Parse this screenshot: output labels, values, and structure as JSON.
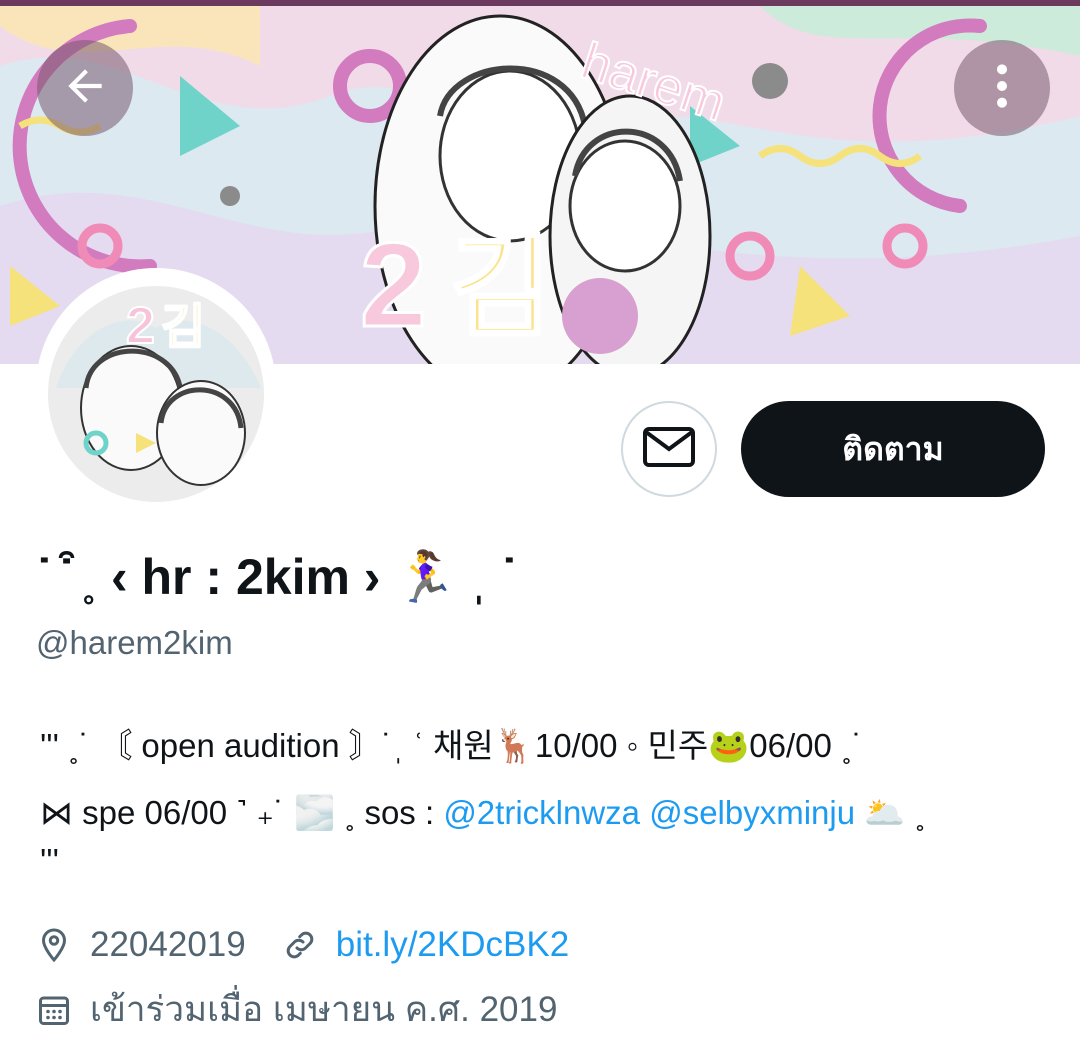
{
  "header": {
    "banner_text_top": "harem",
    "banner_text_mid": "2김"
  },
  "actions": {
    "follow_label": "ติดตาม"
  },
  "profile": {
    "display_name": "˙ ͒ ˳ ‹ hr : 2kim › 🏃‍♀️ ˌ ˙",
    "handle": "@harem2kim",
    "bio_line1": "''' ˳˙ 〘 open audition 〙˙ˌ ʿ 채원🦌10/00 ◦ 민주🐸06/00 ˳˙",
    "bio_line2_prefix": "⋈ spe 06/00 ˺ ₊˙ 🌫️ ˳ sos : ",
    "mention1": "@2tricklnwza",
    "mention2": "@selbyxminju",
    "bio_line2_suffix": " 🌥️ ˳",
    "bio_line3": "'''",
    "location": "22042019",
    "link": "bit.ly/2KDcBK2",
    "joined": "เข้าร่วมเมื่อ เมษายน ค.ศ. 2019"
  },
  "icons": {
    "back": "arrow-left-icon",
    "more": "more-vertical-icon",
    "message": "envelope-icon",
    "location": "location-pin-icon",
    "link": "link-icon",
    "calendar": "calendar-icon"
  },
  "colors": {
    "link": "#1d9bf0",
    "follow_button": "#0f1419",
    "secondary_text": "#536471"
  }
}
